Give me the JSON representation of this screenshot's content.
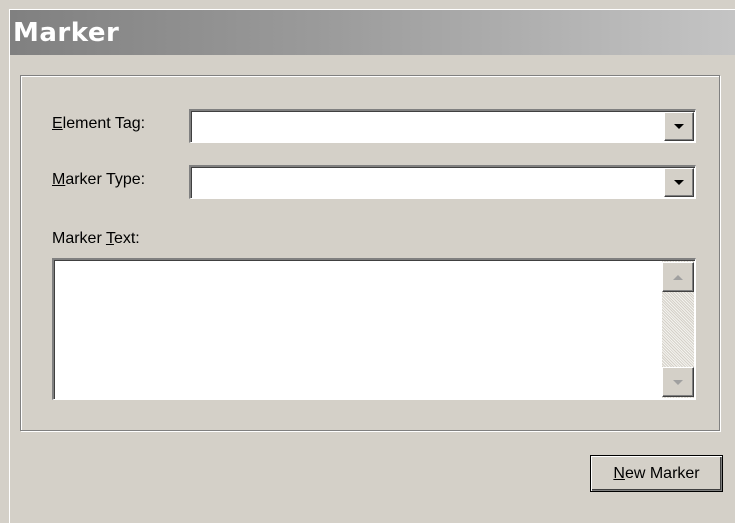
{
  "title": "Marker",
  "form": {
    "element_tag": {
      "label_mnemonic": "E",
      "label_rest": "lement Tag:",
      "value": ""
    },
    "marker_type": {
      "label_mnemonic": "M",
      "label_rest": "arker Type:",
      "value": ""
    },
    "marker_text": {
      "label_before": "Marker ",
      "label_mnemonic": "T",
      "label_rest": "ext:",
      "value": ""
    }
  },
  "buttons": {
    "new_marker": {
      "label_mnemonic": "N",
      "label_rest": "ew Marker"
    }
  },
  "icons": {
    "dropdown": "chevron-down-icon",
    "scroll_up": "scroll-up-arrow-icon",
    "scroll_down": "scroll-down-arrow-icon"
  },
  "colors": {
    "face": "#d4d0c8",
    "title_gradient_start": "#808080",
    "title_gradient_end": "#c4c4c4",
    "title_text": "#ffffff"
  }
}
